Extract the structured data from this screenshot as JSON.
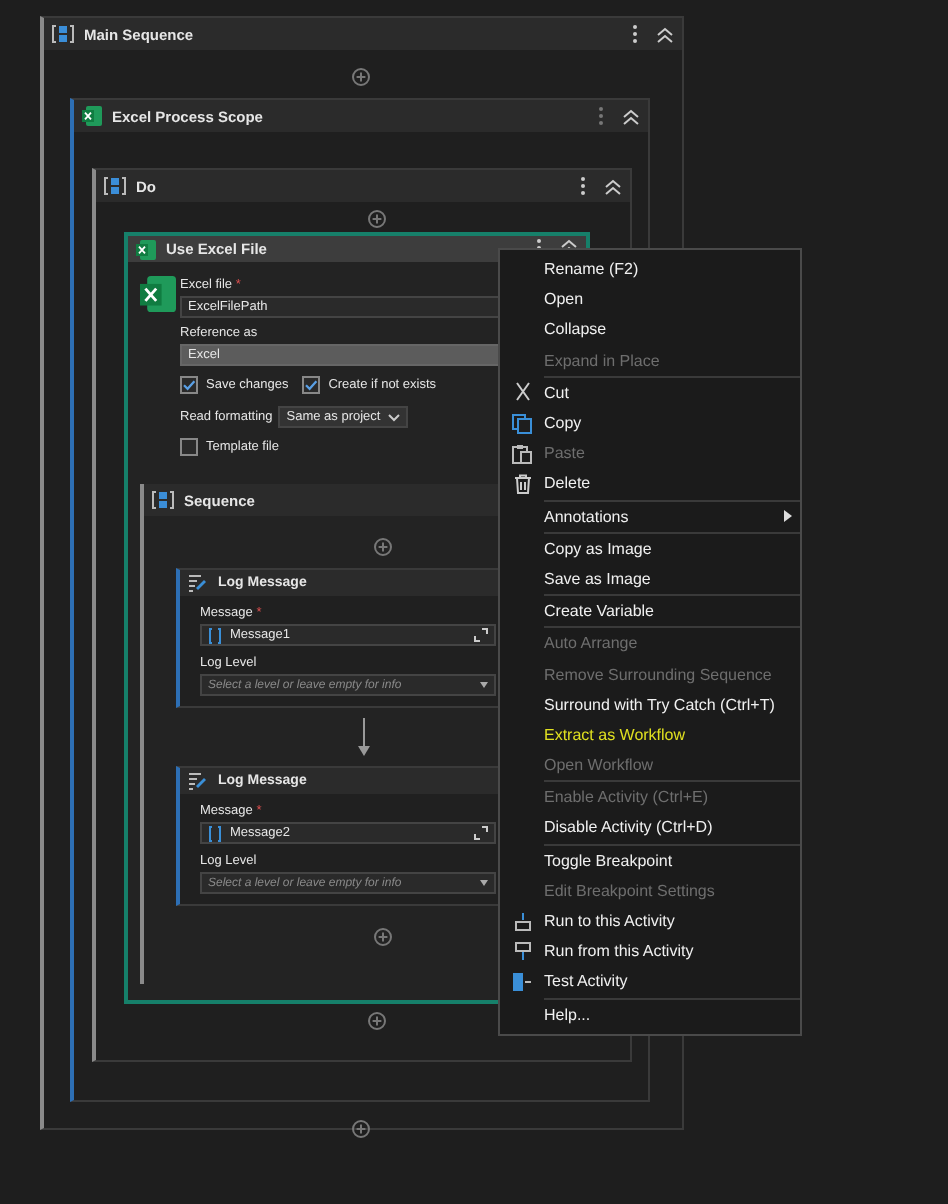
{
  "main": {
    "title": "Main Sequence"
  },
  "scope": {
    "title": "Excel Process Scope"
  },
  "do": {
    "title": "Do"
  },
  "activity": {
    "title": "Use Excel File",
    "excel_file": {
      "label": "Excel file",
      "required_mark": "*",
      "value": "ExcelFilePath"
    },
    "reference_as": {
      "label": "Reference as",
      "value": "Excel"
    },
    "checkboxes": [
      {
        "label": "Save changes",
        "checked": true
      },
      {
        "label": "Create if not exists",
        "checked": true
      }
    ],
    "read_formatting": {
      "label": "Read formatting",
      "value": "Same as project"
    },
    "template_file": {
      "label": "Template file",
      "checked": false
    },
    "sequence": {
      "title": "Sequence",
      "activities": [
        {
          "title": "Log Message",
          "message_label": "Message",
          "required_mark": "*",
          "message": "Message1",
          "level_label": "Log Level",
          "level_placeholder": "Select a level or leave empty for info"
        },
        {
          "title": "Log Message",
          "message_label": "Message",
          "required_mark": "*",
          "message": "Message2",
          "level_label": "Log Level",
          "level_placeholder": "Select a level or leave empty for info"
        }
      ]
    }
  },
  "context_menu": {
    "groups": [
      [
        {
          "label": "Rename (F2)",
          "disabled": false,
          "selected": false,
          "submenu": false
        },
        {
          "label": "Open",
          "disabled": false,
          "selected": false,
          "submenu": false
        },
        {
          "label": "Collapse",
          "disabled": false,
          "selected": false,
          "submenu": false
        },
        {
          "label": "Expand in Place",
          "disabled": true,
          "selected": false,
          "submenu": false
        }
      ],
      [
        {
          "label": "Cut",
          "kind": "cut",
          "disabled": false,
          "selected": false,
          "submenu": false
        },
        {
          "label": "Copy",
          "kind": "copy",
          "disabled": false,
          "selected": false,
          "submenu": false
        },
        {
          "label": "Paste",
          "kind": "paste",
          "disabled": true,
          "selected": false,
          "submenu": false
        },
        {
          "label": "Delete",
          "kind": "delete",
          "disabled": false,
          "selected": false,
          "submenu": false
        }
      ],
      [
        {
          "label": "Annotations",
          "disabled": false,
          "selected": false,
          "submenu": true
        }
      ],
      [
        {
          "label": "Copy as Image",
          "disabled": false,
          "selected": false,
          "submenu": false
        },
        {
          "label": "Save as Image",
          "disabled": false,
          "selected": false,
          "submenu": false
        }
      ],
      [
        {
          "label": "Create Variable",
          "disabled": false,
          "selected": false,
          "submenu": false
        }
      ],
      [
        {
          "label": "Auto Arrange",
          "disabled": true,
          "selected": false,
          "submenu": false
        },
        {
          "label": "Remove Surrounding Sequence",
          "disabled": true,
          "selected": false,
          "submenu": false
        },
        {
          "label": "Surround with Try Catch (Ctrl+T)",
          "disabled": false,
          "selected": false,
          "submenu": false
        },
        {
          "label": "Extract as Workflow",
          "disabled": false,
          "selected": true,
          "submenu": false
        },
        {
          "label": "Open Workflow",
          "disabled": true,
          "selected": false,
          "submenu": false
        }
      ],
      [
        {
          "label": "Enable Activity (Ctrl+E)",
          "disabled": true,
          "selected": false,
          "submenu": false
        },
        {
          "label": "Disable Activity (Ctrl+D)",
          "disabled": false,
          "selected": false,
          "submenu": false
        }
      ],
      [
        {
          "label": "Toggle Breakpoint",
          "disabled": false,
          "selected": false,
          "submenu": false
        },
        {
          "label": "Edit Breakpoint Settings",
          "disabled": true,
          "selected": false,
          "submenu": false
        },
        {
          "label": "Run to this Activity",
          "kind": "run-to",
          "disabled": false,
          "selected": false,
          "submenu": false
        },
        {
          "label": "Run from this Activity",
          "kind": "run-from",
          "disabled": false,
          "selected": false,
          "submenu": false
        },
        {
          "label": "Test Activity",
          "kind": "test",
          "disabled": false,
          "selected": false,
          "submenu": false
        }
      ],
      [
        {
          "label": "Help...",
          "disabled": false,
          "selected": false,
          "submenu": false
        }
      ]
    ]
  }
}
